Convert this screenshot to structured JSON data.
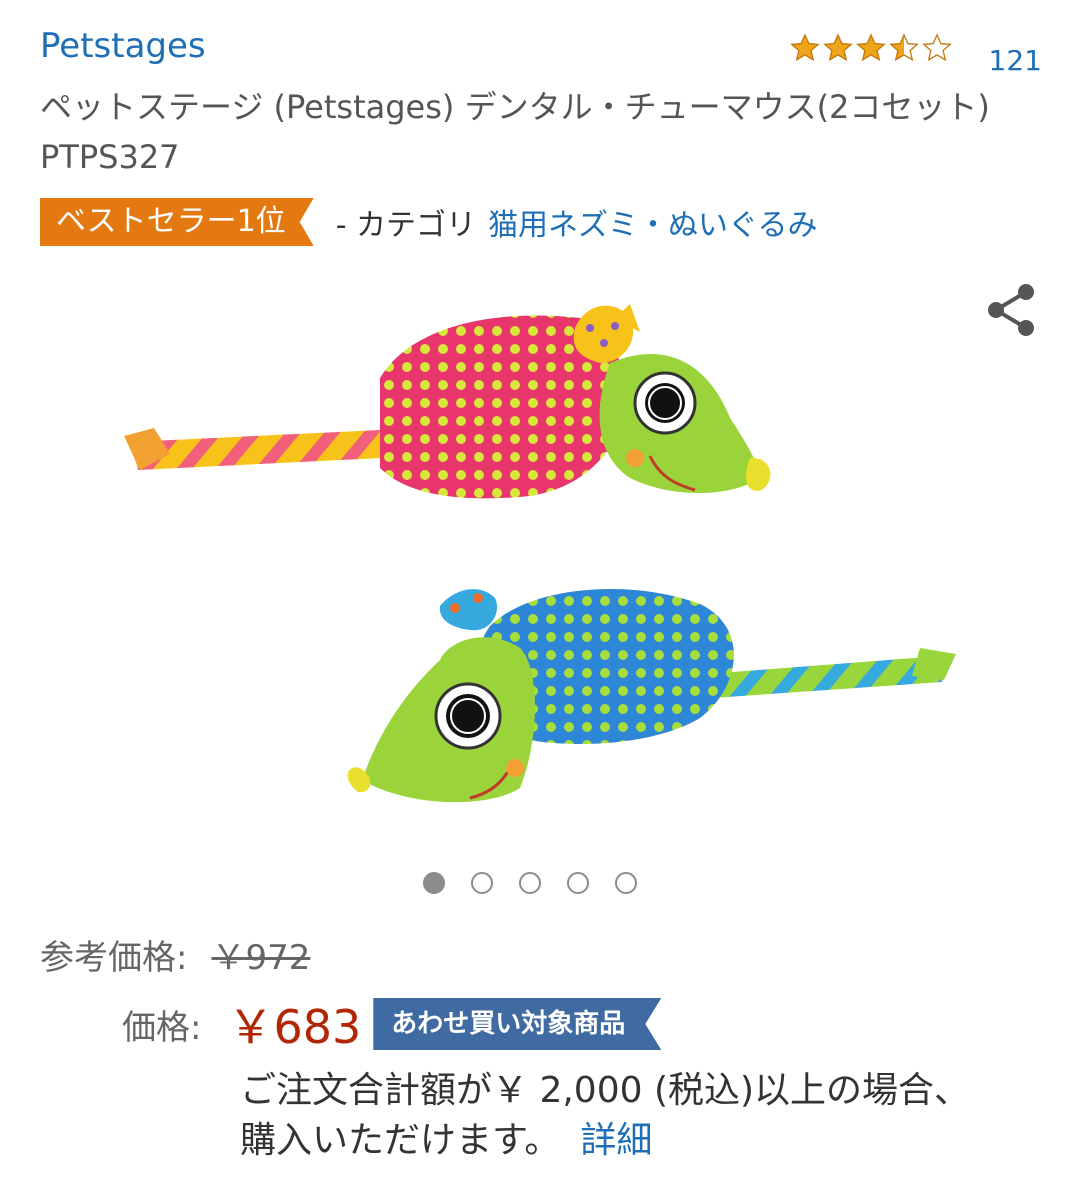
{
  "brand": "Petstages",
  "rating": {
    "stars": 3.5,
    "star_icons": [
      "star-full-icon",
      "star-full-icon",
      "star-full-icon",
      "star-half-icon",
      "star-empty-icon"
    ],
    "review_count": "121"
  },
  "title": "ペットステージ (Petstages) デンタル・チューマウス(2コセット) PTPS327",
  "bestseller": {
    "badge": "ベストセラー1位",
    "category_prefix": "- カテゴリ",
    "category_link": "猫用ネズミ・ぬいぐるみ"
  },
  "image": {
    "carousel_count": 5,
    "active_index": 0
  },
  "pricing": {
    "ref_label": "参考価格:",
    "ref_price": "￥972",
    "price_label": "価格:",
    "price": "￥683",
    "addon_badge": "あわせ買い対象商品",
    "note": "ご注文合計額が￥ 2,000 (税込)以上の場合、購入いただけます。",
    "detail_link": "詳細"
  },
  "colors": {
    "link": "#1e6fb5",
    "bestseller": "#e47911",
    "price": "#b12704",
    "addon": "#3f6aa2",
    "star": "#f0a41a"
  }
}
